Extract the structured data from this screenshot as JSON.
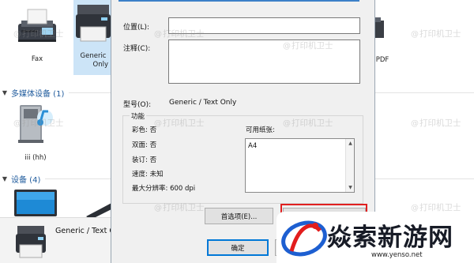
{
  "background": {
    "devices_top": [
      {
        "name": "fax",
        "label": "Fax"
      },
      {
        "name": "generic-printer",
        "label": "Generic",
        "label2": "Only"
      },
      {
        "name": "pdf-printer",
        "label": "PDF"
      }
    ],
    "sections": [
      {
        "title": "多媒体设备 (1)"
      },
      {
        "title": "设备 (4)"
      }
    ],
    "media_device": {
      "label": "iii (hh)"
    },
    "selected_device_name": "Generic / Text C"
  },
  "dialog": {
    "location_label": "位置(L):",
    "comment_label": "注释(C):",
    "model_label": "型号(O):",
    "model_value": "Generic / Text Only",
    "features": {
      "title": "功能",
      "color": "彩色: 否",
      "duplex": "双面: 否",
      "staple": "装订: 否",
      "speed": "速度: 未知",
      "max_resolution": "最大分辨率: 600 dpi",
      "paper_label": "可用纸张:",
      "paper_items": [
        "A4"
      ]
    },
    "preferences_button": "首选项(E)...",
    "ok_button": "确定"
  },
  "watermark": "打印机卫士",
  "logo": {
    "text": "焱索新游网",
    "url": "www.yenso.net"
  },
  "colors": {
    "accent": "#3c80c8",
    "highlight": "#e02020",
    "link": "#1e5a9c"
  }
}
